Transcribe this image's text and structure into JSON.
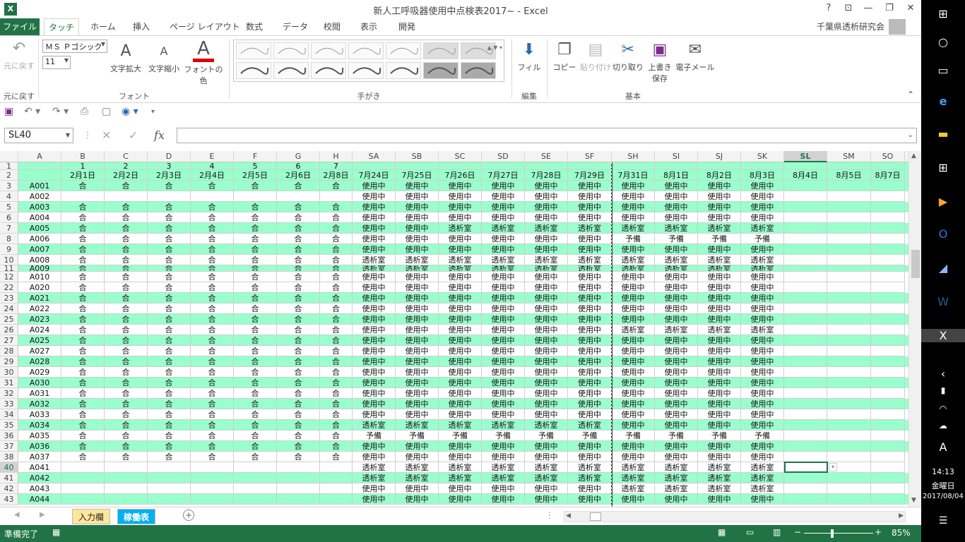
{
  "window": {
    "title": "新人工呼吸器使用中点検表2017~ - Excel",
    "help": "?",
    "ribbon_display": "⊡",
    "minimize": "—",
    "restore": "❐",
    "close": "✕"
  },
  "ribbon_tabs": [
    "ファイル",
    "タッチ",
    "ホーム",
    "挿入",
    "ページ レイアウト",
    "数式",
    "データ",
    "校閲",
    "表示",
    "開発"
  ],
  "user": "千葉県透析研究会",
  "ribbon": {
    "undo": "元に戻す",
    "undo_group": "元に戻す",
    "font_name": "ＭＳ Ｐゴシック",
    "font_size": "11",
    "grow": "文字拡大",
    "shrink": "文字縮小",
    "font_color": "フォントの色",
    "font_group": "フォント",
    "ink_group": "手がき",
    "fill": "フィル",
    "edit_group": "編集",
    "copy": "コピー",
    "paste": "貼り付け",
    "cut": "切り取り",
    "save_line1": "上書き",
    "save_line2": "保存",
    "email": "電子メール",
    "basic_group": "基本"
  },
  "name_box": "SL40",
  "fx": "fx",
  "columns": [
    "A",
    "B",
    "C",
    "D",
    "E",
    "F",
    "G",
    "H",
    "SA",
    "SB",
    "SC",
    "SD",
    "SE",
    "SF",
    "SH",
    "SI",
    "SJ",
    "SK",
    "SL",
    "SM",
    "SO"
  ],
  "selected_column": "SL",
  "row1": [
    "",
    "1",
    "2",
    "3",
    "4",
    "5",
    "6",
    "7",
    "",
    "",
    "",
    "",
    "",
    "",
    "",
    "",
    "",
    "",
    "",
    "",
    ""
  ],
  "row2": [
    "",
    "2月1日",
    "2月2日",
    "2月3日",
    "2月4日",
    "2月5日",
    "2月6日",
    "2月8日",
    "7月24日",
    "7月25日",
    "7月26日",
    "7月27日",
    "7月28日",
    "7月29日",
    "7月31日",
    "8月1日",
    "8月2日",
    "8月3日",
    "8月4日",
    "8月5日",
    "8月7日"
  ],
  "rows": [
    {
      "n": "3",
      "id": "A001",
      "b": "合合合合合合合",
      "s": [
        "使用中",
        "使用中",
        "使用中",
        "使用中",
        "使用中",
        "使用中",
        "使用中",
        "使用中",
        "使用中",
        "使用中"
      ]
    },
    {
      "n": "4",
      "id": "A002",
      "b": "",
      "s": [
        "使用中",
        "使用中",
        "使用中",
        "使用中",
        "使用中",
        "使用中",
        "使用中",
        "使用中",
        "使用中",
        "使用中"
      ]
    },
    {
      "n": "5",
      "id": "A003",
      "b": "合合合合合合合",
      "s": [
        "使用中",
        "使用中",
        "使用中",
        "使用中",
        "使用中",
        "使用中",
        "使用中",
        "使用中",
        "使用中",
        "使用中"
      ]
    },
    {
      "n": "6",
      "id": "A004",
      "b": "合合合合合合合",
      "s": [
        "使用中",
        "使用中",
        "使用中",
        "使用中",
        "使用中",
        "使用中",
        "使用中",
        "使用中",
        "使用中",
        "使用中"
      ]
    },
    {
      "n": "7",
      "id": "A005",
      "b": "合合合合合合合",
      "s": [
        "使用中",
        "使用中",
        "透析室",
        "透析室",
        "透析室",
        "透析室",
        "透析室",
        "透析室",
        "透析室",
        "透析室"
      ]
    },
    {
      "n": "8",
      "id": "A006",
      "b": "合合合合合合合",
      "s": [
        "使用中",
        "使用中",
        "使用中",
        "使用中",
        "使用中",
        "使用中",
        "予備",
        "予備",
        "予備",
        "予備"
      ]
    },
    {
      "n": "9",
      "id": "A007",
      "b": "合合合合合合合",
      "s": [
        "使用中",
        "使用中",
        "使用中",
        "使用中",
        "使用中",
        "使用中",
        "使用中",
        "使用中",
        "使用中",
        "使用中"
      ]
    },
    {
      "n": "10",
      "id": "A008",
      "b": "合合合合合合合",
      "s": [
        "透析室",
        "透析室",
        "透析室",
        "透析室",
        "透析室",
        "透析室",
        "透析室",
        "透析室",
        "透析室",
        "透析室"
      ]
    },
    {
      "n": "11",
      "id": "A009",
      "b": "合合合合合合合",
      "s": [
        "透析室",
        "透析室",
        "透析室",
        "透析室",
        "透析室",
        "透析室",
        "透析室",
        "透析室",
        "透析室",
        "透析室"
      ]
    },
    {
      "n": "12",
      "id": "A010",
      "b": "合合合合合合合",
      "s": [
        "使用中",
        "使用中",
        "使用中",
        "使用中",
        "使用中",
        "使用中",
        "使用中",
        "使用中",
        "使用中",
        "使用中"
      ]
    },
    {
      "n": "22",
      "id": "A020",
      "b": "合合合合合合合",
      "s": [
        "使用中",
        "使用中",
        "使用中",
        "使用中",
        "使用中",
        "使用中",
        "使用中",
        "使用中",
        "使用中",
        "使用中"
      ]
    },
    {
      "n": "23",
      "id": "A021",
      "b": "合合合合合合合",
      "s": [
        "使用中",
        "使用中",
        "使用中",
        "使用中",
        "使用中",
        "使用中",
        "使用中",
        "使用中",
        "使用中",
        "使用中"
      ]
    },
    {
      "n": "24",
      "id": "A022",
      "b": "合合合合合合合",
      "s": [
        "使用中",
        "使用中",
        "使用中",
        "使用中",
        "使用中",
        "使用中",
        "使用中",
        "使用中",
        "使用中",
        "使用中"
      ]
    },
    {
      "n": "25",
      "id": "A023",
      "b": "合合合合合合合",
      "s": [
        "使用中",
        "使用中",
        "使用中",
        "使用中",
        "使用中",
        "使用中",
        "使用中",
        "使用中",
        "使用中",
        "使用中"
      ]
    },
    {
      "n": "26",
      "id": "A024",
      "b": "合合合合合合合",
      "s": [
        "使用中",
        "使用中",
        "使用中",
        "使用中",
        "使用中",
        "使用中",
        "透析室",
        "透析室",
        "透析室",
        "透析室"
      ]
    },
    {
      "n": "27",
      "id": "A025",
      "b": "合合合合合合合",
      "s": [
        "使用中",
        "使用中",
        "使用中",
        "使用中",
        "使用中",
        "使用中",
        "使用中",
        "使用中",
        "使用中",
        "使用中"
      ]
    },
    {
      "n": "28",
      "id": "A027",
      "b": "合合合合合合合",
      "s": [
        "使用中",
        "使用中",
        "使用中",
        "使用中",
        "使用中",
        "使用中",
        "使用中",
        "使用中",
        "使用中",
        "使用中"
      ]
    },
    {
      "n": "29",
      "id": "A028",
      "b": "合合合合合合合",
      "s": [
        "使用中",
        "使用中",
        "使用中",
        "使用中",
        "使用中",
        "使用中",
        "使用中",
        "使用中",
        "使用中",
        "使用中"
      ]
    },
    {
      "n": "30",
      "id": "A029",
      "b": "合合合合合合合",
      "s": [
        "使用中",
        "使用中",
        "使用中",
        "使用中",
        "使用中",
        "使用中",
        "使用中",
        "使用中",
        "使用中",
        "使用中"
      ]
    },
    {
      "n": "31",
      "id": "A030",
      "b": "合合合合合合合",
      "s": [
        "使用中",
        "使用中",
        "使用中",
        "使用中",
        "使用中",
        "使用中",
        "使用中",
        "使用中",
        "使用中",
        "使用中"
      ]
    },
    {
      "n": "32",
      "id": "A031",
      "b": "合合合合合合合",
      "s": [
        "使用中",
        "使用中",
        "使用中",
        "使用中",
        "使用中",
        "使用中",
        "使用中",
        "使用中",
        "使用中",
        "使用中"
      ]
    },
    {
      "n": "33",
      "id": "A032",
      "b": "合合合合合合合",
      "s": [
        "使用中",
        "使用中",
        "使用中",
        "使用中",
        "使用中",
        "使用中",
        "使用中",
        "使用中",
        "使用中",
        "使用中"
      ]
    },
    {
      "n": "34",
      "id": "A033",
      "b": "合合合合合合合",
      "s": [
        "使用中",
        "使用中",
        "使用中",
        "使用中",
        "使用中",
        "使用中",
        "使用中",
        "使用中",
        "使用中",
        "使用中"
      ]
    },
    {
      "n": "35",
      "id": "A034",
      "b": "合合合合合合合",
      "s": [
        "透析室",
        "透析室",
        "透析室",
        "透析室",
        "透析室",
        "透析室",
        "使用中",
        "使用中",
        "使用中",
        "使用中"
      ]
    },
    {
      "n": "36",
      "id": "A035",
      "b": "合合合合合合合",
      "s": [
        "予備",
        "予備",
        "予備",
        "予備",
        "予備",
        "予備",
        "予備",
        "予備",
        "予備",
        "予備"
      ]
    },
    {
      "n": "37",
      "id": "A036",
      "b": "合合合合合合合",
      "s": [
        "使用中",
        "使用中",
        "使用中",
        "使用中",
        "使用中",
        "使用中",
        "使用中",
        "使用中",
        "使用中",
        "使用中"
      ]
    },
    {
      "n": "38",
      "id": "A037",
      "b": "合合合合合合合",
      "s": [
        "使用中",
        "使用中",
        "使用中",
        "使用中",
        "使用中",
        "使用中",
        "使用中",
        "使用中",
        "使用中",
        "使用中"
      ]
    },
    {
      "n": "40",
      "id": "A041",
      "b": "",
      "s": [
        "透析室",
        "透析室",
        "透析室",
        "透析室",
        "透析室",
        "透析室",
        "透析室",
        "透析室",
        "透析室",
        "透析室"
      ]
    },
    {
      "n": "41",
      "id": "A042",
      "b": "",
      "s": [
        "透析室",
        "透析室",
        "透析室",
        "透析室",
        "透析室",
        "透析室",
        "透析室",
        "透析室",
        "透析室",
        "透析室"
      ]
    },
    {
      "n": "42",
      "id": "A043",
      "b": "",
      "s": [
        "使用中",
        "使用中",
        "使用中",
        "使用中",
        "使用中",
        "使用中",
        "透析室",
        "透析室",
        "透析室",
        "透析室"
      ]
    },
    {
      "n": "43",
      "id": "A044",
      "b": "",
      "s": [
        "使用中",
        "使用中",
        "使用中",
        "使用中",
        "使用中",
        "使用中",
        "使用中",
        "使用中",
        "使用中",
        "使用中"
      ]
    }
  ],
  "sheets": [
    "入力欄",
    "稼働表"
  ],
  "status": {
    "ready": "準備完了",
    "zoom": "85%",
    "zoom_minus": "−",
    "zoom_plus": "+"
  },
  "taskbar": {
    "time": "14:13",
    "day": "金曜日",
    "date": "2017/08/04",
    "ime": "A",
    "notifications": "2"
  },
  "colors": {
    "excel_green": "#217346",
    "row_fill": "#99ffcc",
    "tab_input": "#ffe699",
    "tab_active": "#00b0f0"
  }
}
